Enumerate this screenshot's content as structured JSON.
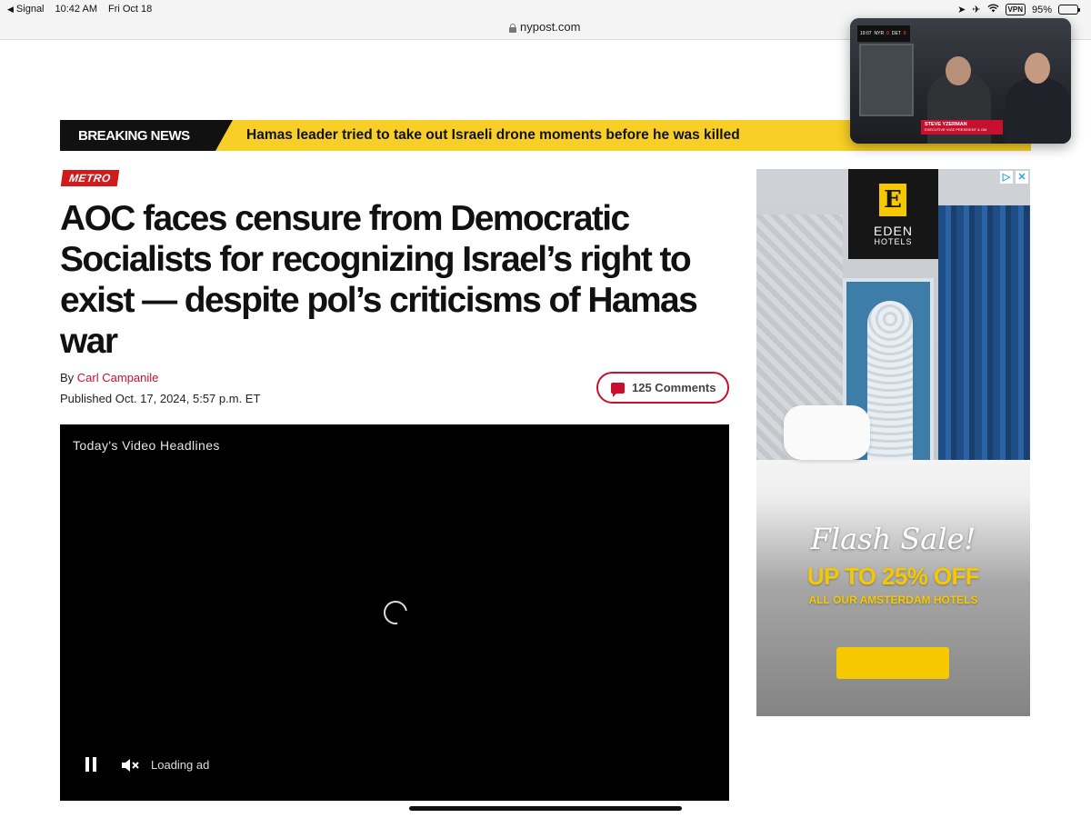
{
  "status_bar": {
    "back_app": "Signal",
    "time": "10:42 AM",
    "date": "Fri Oct 18",
    "vpn": "VPN",
    "battery": "95%",
    "battery_level": 0.95
  },
  "browser": {
    "url": "nypost.com"
  },
  "pip": {
    "score_left": "19:07",
    "team1": "NYR",
    "team1_score": "0",
    "team2": "DET",
    "team2_score": "0",
    "lower_third_name": "STEVE YZERMAN",
    "lower_third_title": "EXECUTIVE VICE PRESIDENT & GM"
  },
  "breaking_news": {
    "label": "BREAKING NEWS",
    "headline": "Hamas leader tried to take out Israeli drone moments before he was killed"
  },
  "article": {
    "section": "METRO",
    "headline": "AOC faces censure from Democratic Socialists for recognizing Israel’s right to exist — despite pol’s criticisms of Hamas war",
    "byline_prefix": "By",
    "author": "Carl Campanile",
    "published": "Published Oct. 17, 2024, 5:57 p.m. ET",
    "comments": "125 Comments"
  },
  "video": {
    "title": "Today's Video Headlines",
    "status": "Loading ad"
  },
  "ad": {
    "brand": "EDEN",
    "brand_sub": "HOTELS",
    "flash": "Flash Sale!",
    "offer": "UP TO 25% OFF",
    "offer_sub": "ALL OUR AMSTERDAM HOTELS"
  },
  "colors": {
    "brand_red": "#c8102e",
    "breaking_yellow": "#f7cf26",
    "ad_yellow": "#f5c800"
  }
}
